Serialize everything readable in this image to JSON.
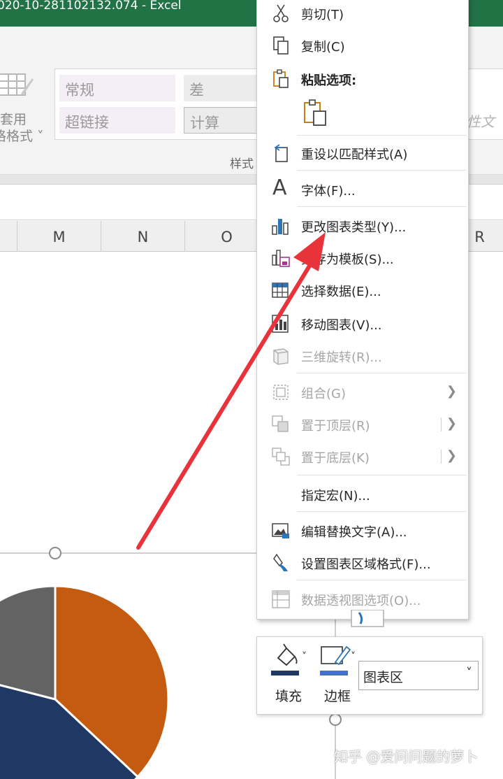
{
  "window": {
    "title": "020-10-281102132.074  -  Excel"
  },
  "ribbon": {
    "table_format_label_line1": "套用",
    "table_format_label_line2": "格格式 ˅",
    "styles": {
      "normal": "常规",
      "bad": "差",
      "hyperlink": "超链接",
      "calculation": "计算"
    },
    "group_label": "样式",
    "right_partial": "释性文"
  },
  "columns": [
    "M",
    "N",
    "O",
    "R"
  ],
  "chart_data": {
    "type": "pie",
    "categories": [],
    "series": [
      {
        "values": [
          37,
          42,
          21
        ],
        "colors": [
          "#c55a11",
          "#203864",
          "#636363"
        ]
      }
    ]
  },
  "context_menu": {
    "items": [
      {
        "label": "剪切(T)",
        "icon": "scissors-icon",
        "disabled": false
      },
      {
        "label": "复制(C)",
        "icon": "copy-icon",
        "disabled": false
      },
      {
        "label": "粘贴选项:",
        "icon": "paste-icon",
        "disabled": false
      },
      {
        "label": "重设以匹配样式(A)",
        "icon": "reset-style-icon",
        "disabled": false
      },
      {
        "label": "字体(F)...",
        "icon": "font-icon",
        "disabled": false
      },
      {
        "label": "更改图表类型(Y)...",
        "icon": "chart-type-icon",
        "disabled": false
      },
      {
        "label": "另存为模板(S)...",
        "icon": "save-template-icon",
        "disabled": false
      },
      {
        "label": "选择数据(E)...",
        "icon": "select-data-icon",
        "disabled": false
      },
      {
        "label": "移动图表(V)...",
        "icon": "move-chart-icon",
        "disabled": false
      },
      {
        "label": "三维旋转(R)...",
        "icon": "3d-rotation-icon",
        "disabled": true
      },
      {
        "label": "组合(G)",
        "icon": "group-icon",
        "disabled": true
      },
      {
        "label": "置于顶层(R)",
        "icon": "bring-front-icon",
        "disabled": true
      },
      {
        "label": "置于底层(K)",
        "icon": "send-back-icon",
        "disabled": true
      },
      {
        "label": "指定宏(N)...",
        "icon": "",
        "disabled": false
      },
      {
        "label": "编辑替换文字(A)...",
        "icon": "alt-text-icon",
        "disabled": false
      },
      {
        "label": "设置图表区域格式(F)...",
        "icon": "format-chart-area-icon",
        "disabled": false
      },
      {
        "label": "数据透视图选项(O)...",
        "icon": "pivot-chart-options-icon",
        "disabled": true
      }
    ]
  },
  "mini_toolbar": {
    "fill_label": "填充",
    "border_label": "边框",
    "selected_element": "图表区",
    "fill_color": "#1f3864",
    "border_color": "#4472c4"
  },
  "watermark": "知乎 @爱问问题的萝卜",
  "annotation_color": "#e8333a"
}
